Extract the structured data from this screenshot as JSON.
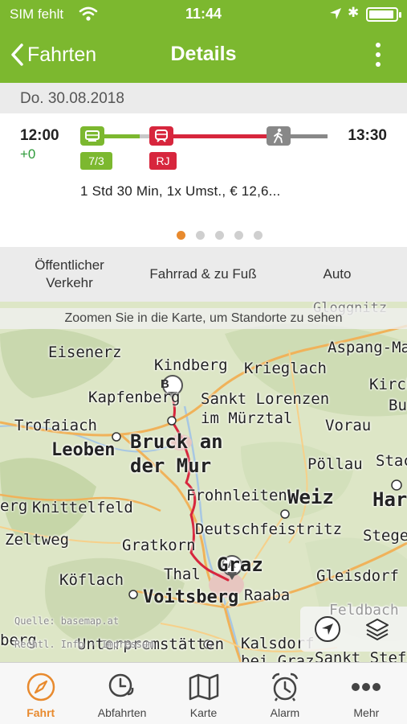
{
  "status_bar": {
    "carrier": "SIM fehlt",
    "time": "11:44"
  },
  "nav": {
    "back_label": "Fahrten",
    "title": "Details"
  },
  "date": "Do. 30.08.2018",
  "trip": {
    "departure": "12:00",
    "delay": "+0",
    "arrival": "13:30",
    "segments": [
      {
        "type": "tram",
        "badge": "7/3",
        "color": "#7cb82f"
      },
      {
        "type": "train",
        "badge": "RJ",
        "color": "#d7263d"
      },
      {
        "type": "walk",
        "badge": "",
        "color": "#888888"
      }
    ],
    "summary": "1 Std 30 Min,  1x Umst.,  € 12,6...",
    "page_count": 5,
    "active_page": 0
  },
  "mode_tabs": [
    {
      "label_line1": "Öffentlicher",
      "label_line2": "Verkehr"
    },
    {
      "label_line1": "Fahrrad & zu Fuß",
      "label_line2": ""
    },
    {
      "label_line1": "Auto",
      "label_line2": ""
    }
  ],
  "map": {
    "hint": "Zoomen Sie in die Karte, um Standorte zu sehen",
    "attribution_source": "Quelle: basemap.at",
    "attribution_rights": "Rechtl. Info · Impressum",
    "places": {
      "gloggnitz": "Gloggnitz",
      "eisenerz": "Eisenerz",
      "kindberg": "Kindberg",
      "krieglach": "Krieglach",
      "aspang": "Aspang-Ma",
      "kirch": "Kirch",
      "bu": "Bu",
      "kapfenberg": "Kapfenberg",
      "sankt_lorenzen": "Sankt Lorenzen",
      "muerztal": "im Mürztal",
      "trofaiach": "Trofaiach",
      "vorau": "Vorau",
      "leoben": "Leoben",
      "bruck1": "Bruck an",
      "bruck2": "der Mur",
      "poellau": "Pöllau",
      "stac": "Stac",
      "frohnleiten": "Frohnleiten",
      "weiz": "Weiz",
      "har": "Har",
      "erg": "erg",
      "knittelfeld": "Knittelfeld",
      "deutschfeistritz": "Deutschfeistritz",
      "stege": "Stege",
      "zeltweg": "Zeltweg",
      "gratkorn": "Gratkorn",
      "graz": "Graz",
      "thal": "Thal",
      "gleisdorf": "Gleisdorf",
      "koeflach": "Köflach",
      "voitsberg": "Voitsberg",
      "raaba": "Raaba",
      "feldbach": "Feldbach",
      "berg": "berg",
      "unterpremstaetten": "Unterpremstätten",
      "kalsdorf": "Kalsdorf",
      "bei_graz": "bei Graz",
      "sankt_stefan": "Sankt Stefan"
    },
    "marker_start": "A",
    "marker_end": "B",
    "route_color": "#d7263d"
  },
  "tabbar": [
    {
      "label": "Fahrt",
      "icon": "compass-icon",
      "active": true
    },
    {
      "label": "Abfahrten",
      "icon": "clock-icon",
      "active": false
    },
    {
      "label": "Karte",
      "icon": "map-icon",
      "active": false
    },
    {
      "label": "Alarm",
      "icon": "alarm-clock-icon",
      "active": false
    },
    {
      "label": "Mehr",
      "icon": "more-dots-icon",
      "active": false
    }
  ],
  "colors": {
    "brand_green": "#7cb82f",
    "accent_orange": "#e88a2e",
    "route_red": "#d7263d"
  }
}
